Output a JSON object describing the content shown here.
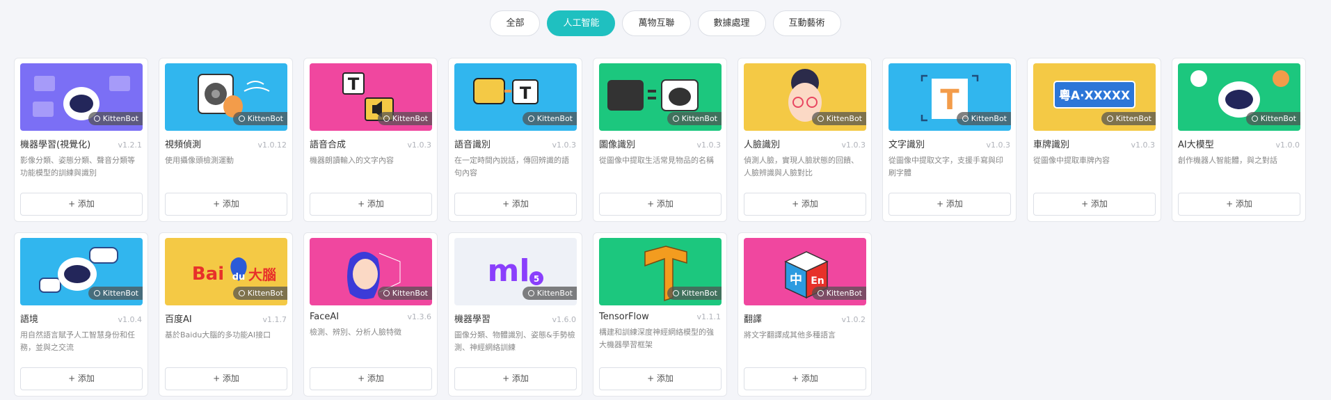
{
  "tabs": [
    {
      "label": "全部",
      "active": false
    },
    {
      "label": "人工智能",
      "active": true
    },
    {
      "label": "萬物互聯",
      "active": false
    },
    {
      "label": "數據處理",
      "active": false
    },
    {
      "label": "互動藝術",
      "active": false
    }
  ],
  "add_label": "+ 添加",
  "author": "KittenBot",
  "cards": [
    {
      "title": "機器學習(視覺化)",
      "version": "v1.2.1",
      "desc": "影像分類、姿態分類、聲音分類等功能模型的訓練與識別",
      "bg": "#7b6ff5",
      "icon": "robot-brain-icon"
    },
    {
      "title": "視頻偵測",
      "version": "v1.0.12",
      "desc": "使用攝像頭檢測運動",
      "bg": "#31b6ee",
      "icon": "camera-hand-icon"
    },
    {
      "title": "語音合成",
      "version": "v1.0.3",
      "desc": "機器朗讀輸入的文字內容",
      "bg": "#f0479f",
      "icon": "text-to-speech-icon"
    },
    {
      "title": "語音識別",
      "version": "v1.0.3",
      "desc": "在一定時間內說話，傳回辨識的語句內容",
      "bg": "#31b6ee",
      "icon": "speech-to-text-icon"
    },
    {
      "title": "圖像識別",
      "version": "v1.0.3",
      "desc": "從圖像中提取生活常見物品的名稱",
      "bg": "#1cc77e",
      "icon": "cat-recognition-icon"
    },
    {
      "title": "人臉識別",
      "version": "v1.0.3",
      "desc": "偵測人臉，實現人臉狀態的回饋、人臉辨識與人臉對比",
      "bg": "#f4c945",
      "icon": "face-icon"
    },
    {
      "title": "文字識別",
      "version": "v1.0.3",
      "desc": "從圖像中提取文字，支援手寫與印刷字體",
      "bg": "#31b6ee",
      "icon": "text-scan-icon"
    },
    {
      "title": "車牌識別",
      "version": "v1.0.3",
      "desc": "從圖像中提取車牌內容",
      "bg": "#f4c945",
      "icon": "license-plate-icon"
    },
    {
      "title": "AI大模型",
      "version": "v1.0.0",
      "desc": "創作機器人智能體，與之對話",
      "bg": "#1cc77e",
      "icon": "ai-robot-icon"
    },
    {
      "title": "語境",
      "version": "v1.0.4",
      "desc": "用自然語言賦予人工智慧身份和任務，並與之交流",
      "bg": "#31b6ee",
      "icon": "chat-robot-icon"
    },
    {
      "title": "百度AI",
      "version": "v1.1.7",
      "desc": "基於Baidu大腦的多功能AI接口",
      "bg": "#f4c945",
      "icon": "baidu-logo-icon"
    },
    {
      "title": "FaceAI",
      "version": "v1.3.6",
      "desc": "檢測、辨別、分析人臉特徵",
      "bg": "#f0479f",
      "icon": "face-mesh-icon"
    },
    {
      "title": "機器學習",
      "version": "v1.6.0",
      "desc": "圖像分類、物體識別、姿態&手勢檢測、神經網絡訓練",
      "bg": "#eef1f7",
      "icon": "ml5-logo-icon"
    },
    {
      "title": "TensorFlow",
      "version": "v1.1.1",
      "desc": "構建和訓練深度神經網絡模型的強大機器學習框架",
      "bg": "#1cc77e",
      "icon": "tensorflow-logo-icon"
    },
    {
      "title": "翻譯",
      "version": "v1.0.2",
      "desc": "將文字翻譯成其他多種語言",
      "bg": "#f0479f",
      "icon": "translate-cube-icon"
    }
  ],
  "thumb_text": {
    "baidu": "Bai",
    "baidu_du": "du",
    "baidu_cn": "大腦",
    "ml5": "ml",
    "ml5_num": "5",
    "plate": "粵A·XXXXX",
    "tts_t": "T",
    "ocr_t": "T",
    "cube_zh": "中",
    "cube_en": "En"
  }
}
